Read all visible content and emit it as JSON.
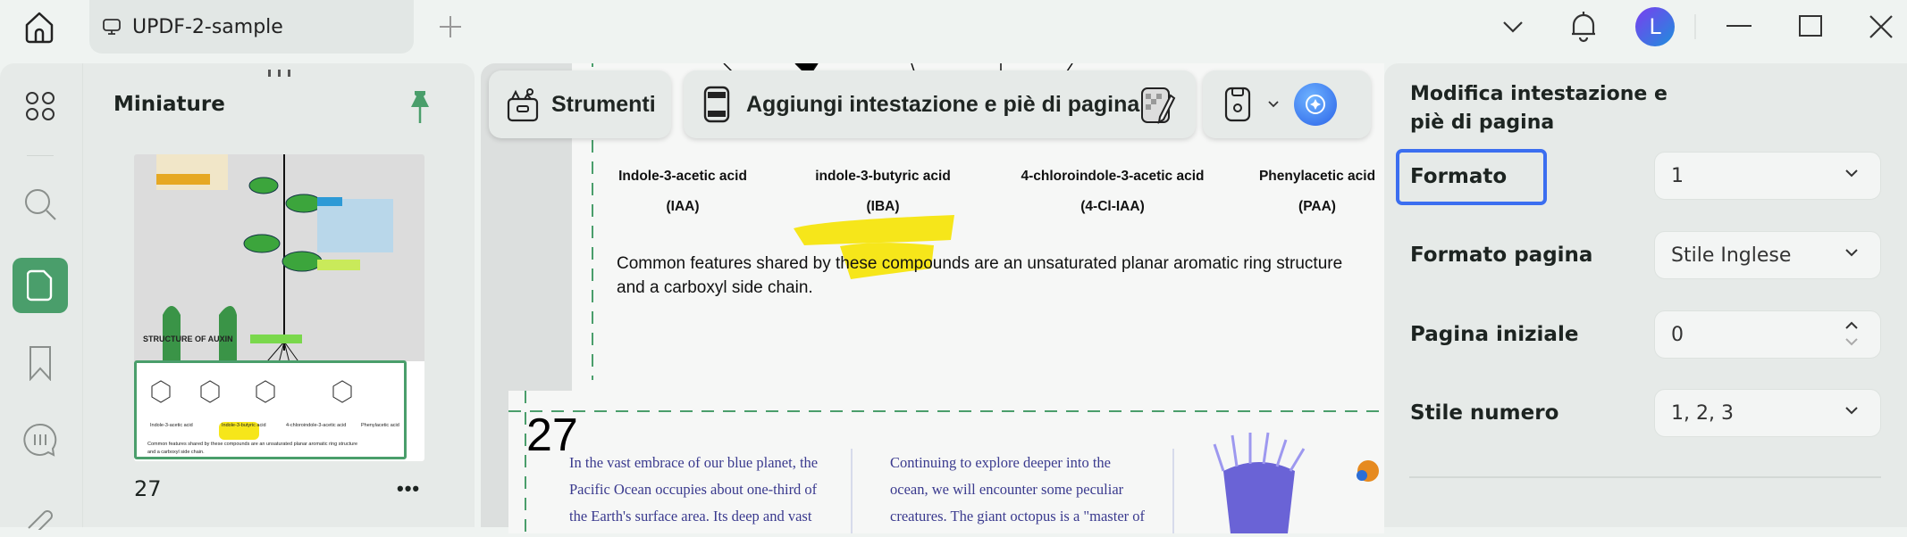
{
  "titlebar": {
    "tab_title": "UPDF-2-sample",
    "avatar_letter": "L"
  },
  "sidebar": {
    "title": "Miniature",
    "thumbnail_page": "27"
  },
  "toolbar": {
    "tools_label": "Strumenti",
    "header_footer_label": "Aggiungi intestazione e piè di pagina"
  },
  "document": {
    "compounds": [
      {
        "name": "Indole-3-acetic acid",
        "abbr": "(IAA)"
      },
      {
        "name": "indole-3-butyric acid",
        "abbr": "(IBA)"
      },
      {
        "name": "4-chloroindole-3-acetic acid",
        "abbr": "(4-Cl-IAA)"
      },
      {
        "name": "Phenylacetic acid",
        "abbr": "(PAA)"
      }
    ],
    "paragraph_line1": "Common features shared by these compounds are an unsaturated planar aromatic ring structure",
    "paragraph_line2": "and a carboxyl side chain.",
    "page_number": "27",
    "col1": [
      "In the vast embrace of our blue planet, the",
      "Pacific Ocean occupies about one-third of",
      "the Earth's surface area. Its deep and vast"
    ],
    "col2": [
      "Continuing to explore deeper into the",
      "ocean, we will encounter some peculiar",
      "creatures. The giant octopus is a \"master of"
    ]
  },
  "panel": {
    "title_line1": "Modifica intestazione e",
    "title_line2": "piè di pagina",
    "fields": [
      {
        "label": "Formato",
        "value": "1"
      },
      {
        "label": "Formato pagina",
        "value": "Stile Inglese"
      },
      {
        "label": "Pagina iniziale",
        "value": "0"
      },
      {
        "label": "Stile numero",
        "value": "1, 2, 3"
      }
    ]
  },
  "colors": {
    "accent": "#4a9e6b",
    "focus": "#3b6ef0",
    "highlight": "#f6e61a"
  }
}
